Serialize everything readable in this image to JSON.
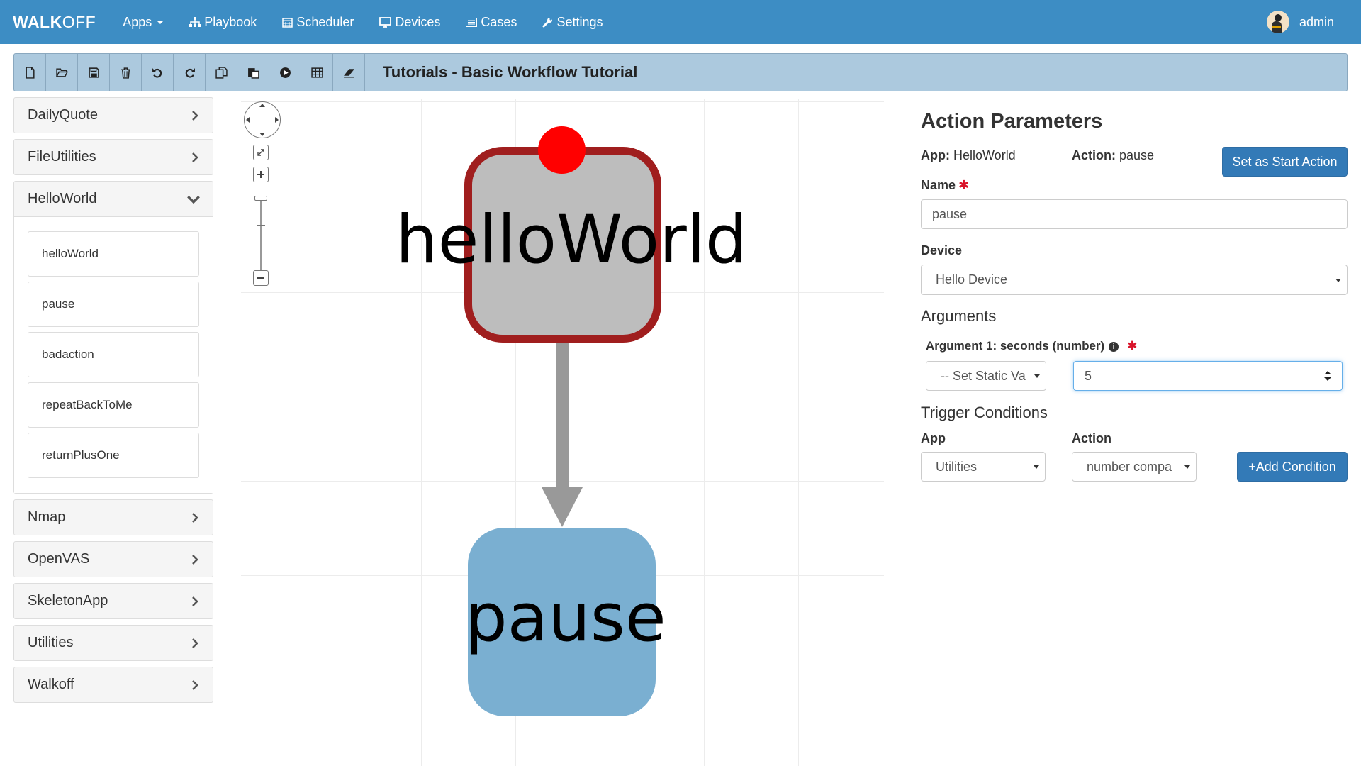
{
  "app": {
    "brand_bold": "WALK",
    "brand_rest": "OFF"
  },
  "nav": {
    "items": [
      {
        "label": "Apps",
        "icon": "none",
        "dropdown": true
      },
      {
        "label": "Playbook",
        "icon": "sitemap-icon"
      },
      {
        "label": "Scheduler",
        "icon": "calendar-icon"
      },
      {
        "label": "Devices",
        "icon": "desktop-icon"
      },
      {
        "label": "Cases",
        "icon": "list-icon"
      },
      {
        "label": "Settings",
        "icon": "wrench-icon"
      }
    ],
    "user": "admin"
  },
  "toolbar": {
    "title": "Tutorials - Basic Workflow Tutorial",
    "buttons": [
      "new-file-icon",
      "open-folder-icon",
      "save-icon",
      "delete-icon",
      "undo-icon",
      "redo-icon",
      "copy-icon",
      "paste-icon",
      "execute-icon",
      "table-icon",
      "eraser-icon"
    ]
  },
  "sidebar": {
    "apps": [
      "DailyQuote",
      "FileUtilities",
      "HelloWorld",
      "Nmap",
      "OpenVAS",
      "SkeletonApp",
      "Utilities",
      "Walkoff"
    ],
    "expanded_app": "HelloWorld",
    "actions": [
      "helloWorld",
      "pause",
      "badaction",
      "repeatBackToMe",
      "returnPlusOne"
    ]
  },
  "graph": {
    "nodes": [
      {
        "label": "helloWorld",
        "selected": true,
        "start": true
      },
      {
        "label": "pause",
        "selected": false,
        "start": false
      }
    ],
    "colors": {
      "selected_border": "#a01e1e",
      "start_marker": "#ff0000",
      "node_default": "#7aafd1",
      "node_selected": "#bdbdbd"
    }
  },
  "params": {
    "heading": "Action Parameters",
    "app_label": "App:",
    "app_value": "HelloWorld",
    "action_label": "Action:",
    "action_value": "pause",
    "start_button": "Set as Start Action",
    "name_label": "Name",
    "name_value": "pause",
    "device_label": "Device",
    "device_value": "Hello Device",
    "arguments_heading": "Arguments",
    "arg1_label": "Argument 1: seconds (number)",
    "arg1_mode": "-- Set Static Va",
    "arg1_value": "5",
    "trigger_heading": "Trigger Conditions",
    "trigger_app_label": "App",
    "trigger_action_label": "Action",
    "trigger_app_value": "Utilities",
    "trigger_action_value": "number compa",
    "add_condition": "+Add Condition"
  }
}
